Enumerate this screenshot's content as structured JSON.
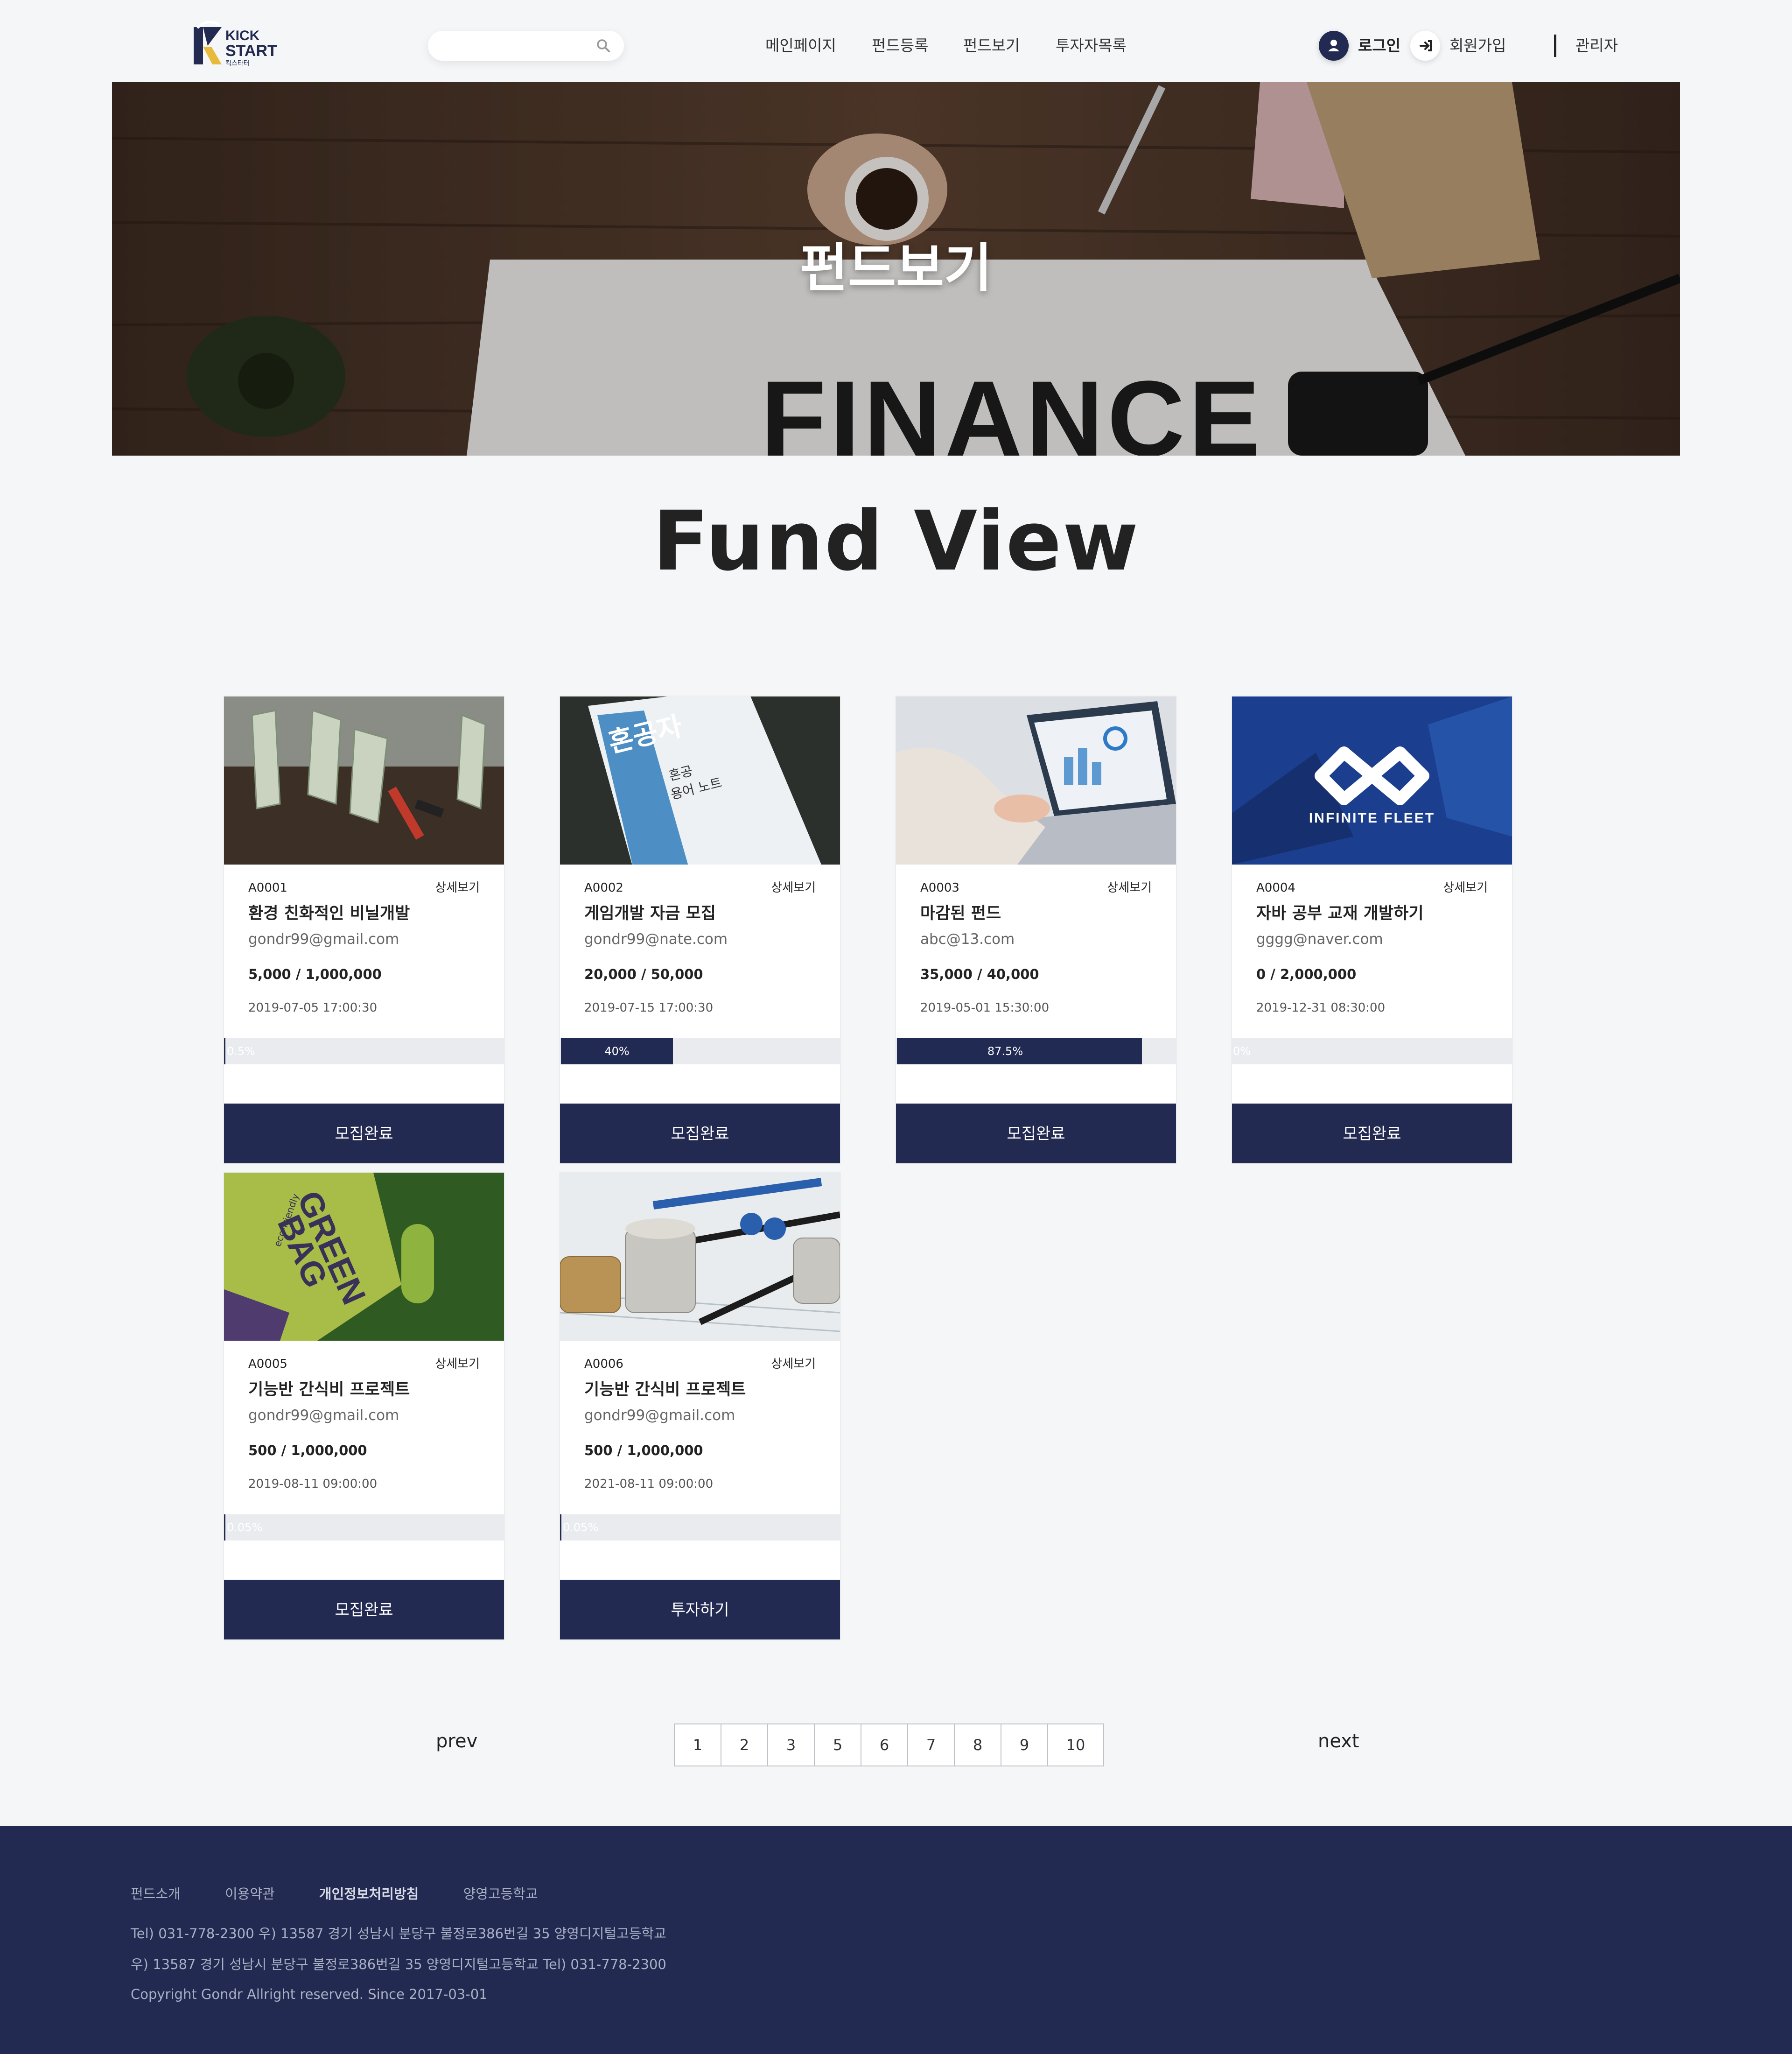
{
  "header": {
    "logo": {
      "line1": "KICK",
      "line2": "START",
      "line3": "킥스타터"
    },
    "search": {
      "placeholder": "",
      "value": ""
    },
    "nav": [
      "메인페이지",
      "펀드등록",
      "펀드보기",
      "투자자목록"
    ],
    "login": "로그인",
    "signup": "회원가입",
    "admin": "관리자"
  },
  "hero": {
    "title": "펀드보기",
    "paper_text": "FINANCE"
  },
  "section_title": "Fund View",
  "cards": [
    {
      "id": "A0001",
      "detail": "상세보기",
      "title": "환경 친화적인 비닐개발",
      "email": "gondr99@gmail.com",
      "amount": "5,000 / 1,000,000",
      "date": "2019-07-05 17:00:30",
      "progress": 0.5,
      "progress_label": "0.5%",
      "button": "모집완료",
      "image": "money-sprouts"
    },
    {
      "id": "A0002",
      "detail": "상세보기",
      "title": "게임개발 자금 모집",
      "email": "gondr99@nate.com",
      "amount": "20,000 / 50,000",
      "date": "2019-07-15 17:00:30",
      "progress": 40,
      "progress_label": "40%",
      "button": "모집완료",
      "image": "notebook",
      "image_text": {
        "big": "혼공자",
        "small1": "혼공",
        "small2": "용어 노트"
      }
    },
    {
      "id": "A0003",
      "detail": "상세보기",
      "title": "마감된 펀드",
      "email": "abc@13.com",
      "amount": "35,000 / 40,000",
      "date": "2019-05-01 15:30:00",
      "progress": 87.5,
      "progress_label": "87.5%",
      "button": "모집완료",
      "image": "laptop"
    },
    {
      "id": "A0004",
      "detail": "상세보기",
      "title": "자바 공부 교재 개발하기",
      "email": "gggg@naver.com",
      "amount": "0 / 2,000,000",
      "date": "2019-12-31 08:30:00",
      "progress": 0,
      "progress_label": "0%",
      "button": "모집완료",
      "image": "infinite-fleet",
      "image_text": {
        "logo": "INFINITE FLEET"
      }
    },
    {
      "id": "A0005",
      "detail": "상세보기",
      "title": "기능반 간식비 프로젝트",
      "email": "gondr99@gmail.com",
      "amount": "500 / 1,000,000",
      "date": "2019-08-11 09:00:00",
      "progress": 0.05,
      "progress_label": "0.05%",
      "button": "모집완료",
      "image": "green-bag",
      "image_text": {
        "line1": "GREEN",
        "line2": "BAG",
        "line3": "eco-friendly"
      }
    },
    {
      "id": "A0006",
      "detail": "상세보기",
      "title": "기능반 간식비 프로젝트",
      "email": "gondr99@gmail.com",
      "amount": "500 / 1,000,000",
      "date": "2021-08-11 09:00:00",
      "progress": 0.05,
      "progress_label": "0.05%",
      "button": "투자하기",
      "image": "coins"
    }
  ],
  "pagination": {
    "prev": "prev",
    "next": "next",
    "pages": [
      "1",
      "2",
      "3",
      "5",
      "6",
      "7",
      "8",
      "9",
      "10"
    ]
  },
  "footer": {
    "links": [
      "펀드소개",
      "이용약관",
      "개인정보처리방침",
      "양영고등학교"
    ],
    "line1": "Tel) 031-778-2300    우) 13587 경기 성남시 분당구 불정로386번길 35 양영디지털고등학교",
    "line2": "우) 13587 경기 성남시 분당구 불정로386번길 35 양영디지털고등학교    Tel) 031-778-2300",
    "copyright": "Copyright Gondr Allright reserved. Since 2017-03-01"
  },
  "colors": {
    "navy": "#222a52",
    "background": "#f5f6f8",
    "progress_track": "#e9ebee"
  }
}
